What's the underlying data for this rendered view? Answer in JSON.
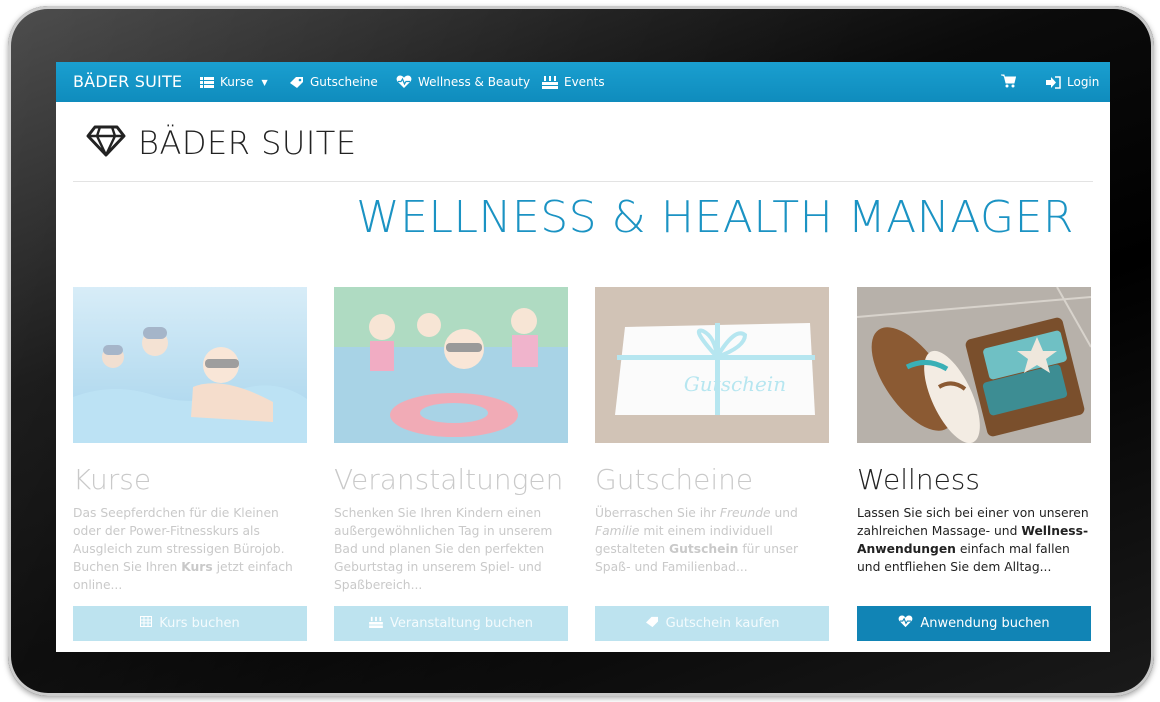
{
  "navbar": {
    "brand": "BÄDER SUITE",
    "items": [
      {
        "label": "Kurse",
        "icon": "list-icon",
        "has_caret": true
      },
      {
        "label": "Gutscheine",
        "icon": "tag-icon"
      },
      {
        "label": "Wellness & Beauty",
        "icon": "heart-pulse-icon"
      },
      {
        "label": "Events",
        "icon": "cake-icon"
      }
    ],
    "cart_icon": "cart-icon",
    "login_label": "Login",
    "login_icon": "login-icon"
  },
  "logo": {
    "text": "BÄDER SUITE",
    "icon": "diamond-icon"
  },
  "hero": {
    "title": "WELLNESS & HEALTH MANAGER"
  },
  "cards": [
    {
      "title": "Kurse",
      "text_parts": [
        "Das Seepferdchen für die Kleinen oder der Power-Fitnesskurs als Ausgleich zum stressigen Bürojob. Buchen Sie Ihren ",
        "Kurs",
        " jetzt einfach online..."
      ],
      "button": "Kurs buchen",
      "button_icon": "table-icon",
      "state": "faded"
    },
    {
      "title": "Veranstaltungen",
      "text": "Schenken Sie Ihren Kindern einen außergewöhnlichen Tag in unserem Bad und planen Sie den perfekten Geburtstag in unserem Spiel- und Spaßbereich...",
      "button": "Veranstaltung buchen",
      "button_icon": "cake-icon",
      "state": "faded"
    },
    {
      "title": "Gutscheine",
      "text_parts": [
        "Überraschen Sie ihr ",
        "Freunde",
        " und ",
        "Familie",
        " mit einem individuell gestalteten ",
        "Gutschein",
        " für unser Spaß- und Familienbad..."
      ],
      "button": "Gutschein kaufen",
      "button_icon": "tag-icon",
      "image_label": "Gutschein",
      "state": "faded"
    },
    {
      "title": "Wellness",
      "text_parts": [
        "Lassen Sie sich bei einer von unseren zahlreichen Massage- und ",
        "Wellness-Anwendungen",
        " einfach mal fallen und entfliehen Sie dem Alltag..."
      ],
      "button": "Anwendung buchen",
      "button_icon": "heart-pulse-icon",
      "state": "active"
    }
  ],
  "colors": {
    "navbar": "#1596c8",
    "hero": "#1b93c3",
    "active_button": "#1184b5",
    "faded_button": "#bde3ef"
  }
}
